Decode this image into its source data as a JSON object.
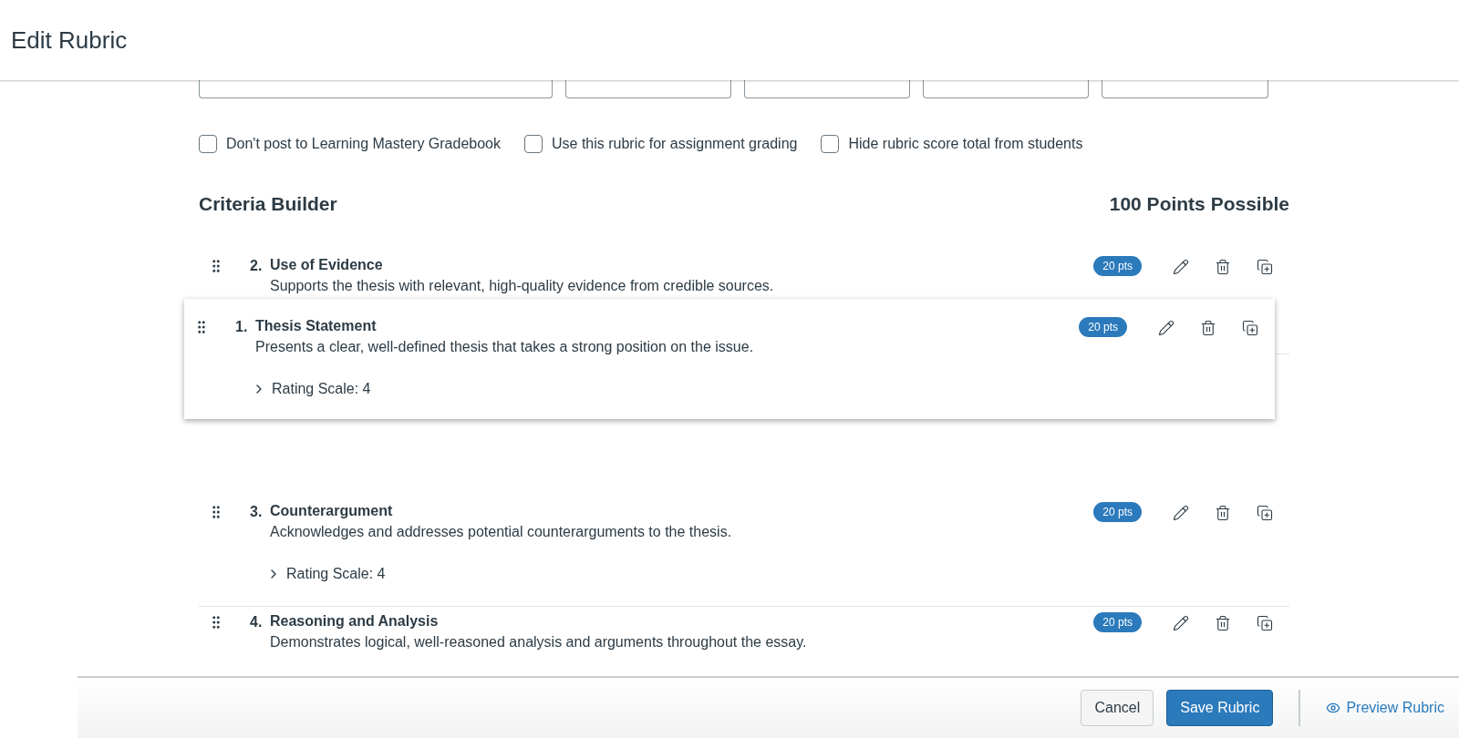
{
  "header": {
    "title": "Edit Rubric"
  },
  "options": [
    {
      "label": "Don't post to Learning Mastery Gradebook",
      "checked": false
    },
    {
      "label": "Use this rubric for assignment grading",
      "checked": false
    },
    {
      "label": "Hide rubric score total from students",
      "checked": false
    }
  ],
  "criteria_builder": {
    "title": "Criteria Builder",
    "total": "100 Points Possible"
  },
  "criteria": [
    {
      "kind": "row",
      "number": "2.",
      "name": "Use of Evidence",
      "description": "Supports the thesis with relevant, high-quality evidence from credible sources.",
      "points": "20 pts"
    },
    {
      "kind": "dragged",
      "number": "1.",
      "name": "Thesis Statement",
      "description": "Presents a clear, well-defined thesis that takes a strong position on the issue.",
      "points": "20 pts",
      "rating": "Rating Scale: 4"
    },
    {
      "kind": "row",
      "number": "3.",
      "name": "Counterargument",
      "description": "Acknowledges and addresses potential counterarguments to the thesis.",
      "points": "20 pts",
      "rating": "Rating Scale: 4"
    },
    {
      "kind": "row",
      "number": "4.",
      "name": "Reasoning and Analysis",
      "description": "Demonstrates logical, well-reasoned analysis and arguments throughout the essay.",
      "points": "20 pts"
    }
  ],
  "footer": {
    "buttons": [
      {
        "label": "Cancel",
        "kind": "secondary"
      },
      {
        "label": "Save Rubric",
        "kind": "primary"
      }
    ],
    "preview_link": "Preview Rubric"
  }
}
